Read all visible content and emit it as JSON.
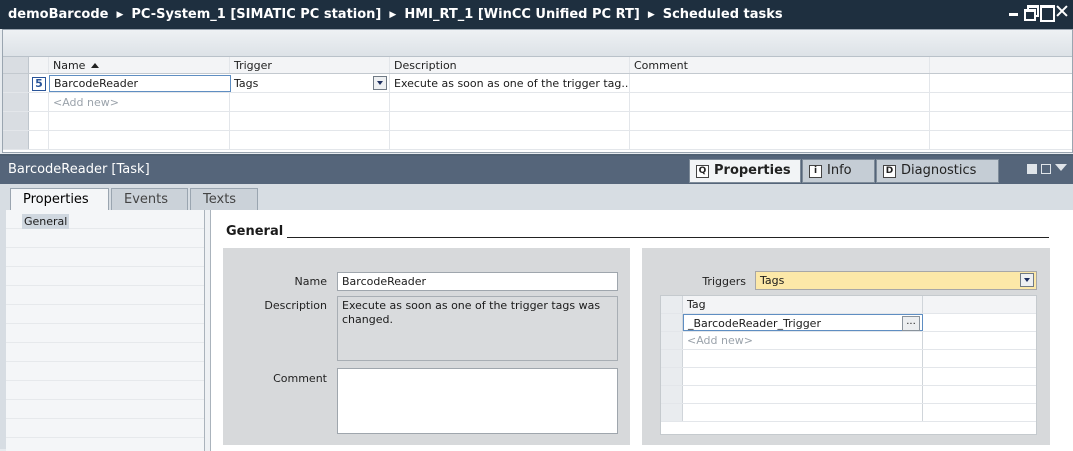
{
  "titlebar": {
    "crumbs": [
      "demoBarcode",
      "PC-System_1 [SIMATIC PC station]",
      "HMI_RT_1 [WinCC Unified PC RT]",
      "Scheduled tasks"
    ],
    "separator": "▶"
  },
  "grid": {
    "headers": {
      "name": "Name",
      "trigger": "Trigger",
      "description": "Description",
      "comment": "Comment"
    },
    "rows": [
      {
        "number": "5",
        "name": "BarcodeReader",
        "trigger": "Tags",
        "description": "Execute as soon as one of the trigger tag...",
        "comment": ""
      }
    ],
    "add_new": "<Add new>"
  },
  "inspector": {
    "title": "BarcodeReader [Task]",
    "tabs": {
      "properties": "Properties",
      "info": "Info",
      "diagnostics": "Diagnostics"
    },
    "subtabs": {
      "properties": "Properties",
      "events": "Events",
      "texts": "Texts"
    },
    "nav": {
      "general": "General"
    },
    "section_title": "General",
    "form": {
      "name_label": "Name",
      "name_value": "BarcodeReader",
      "description_label": "Description",
      "description_value": "Execute as soon as one of the trigger tags was changed.",
      "comment_label": "Comment",
      "comment_value": ""
    },
    "triggers": {
      "label": "Triggers",
      "value": "Tags",
      "column_tag": "Tag",
      "tags": [
        "_BarcodeReader_Trigger"
      ],
      "add_new": "<Add new>",
      "ellipsis": "..."
    }
  },
  "colors": {
    "titlebar": "#1e2f3f",
    "inspector_header": "#55657a",
    "trigger_highlight": "#fce8a8"
  }
}
